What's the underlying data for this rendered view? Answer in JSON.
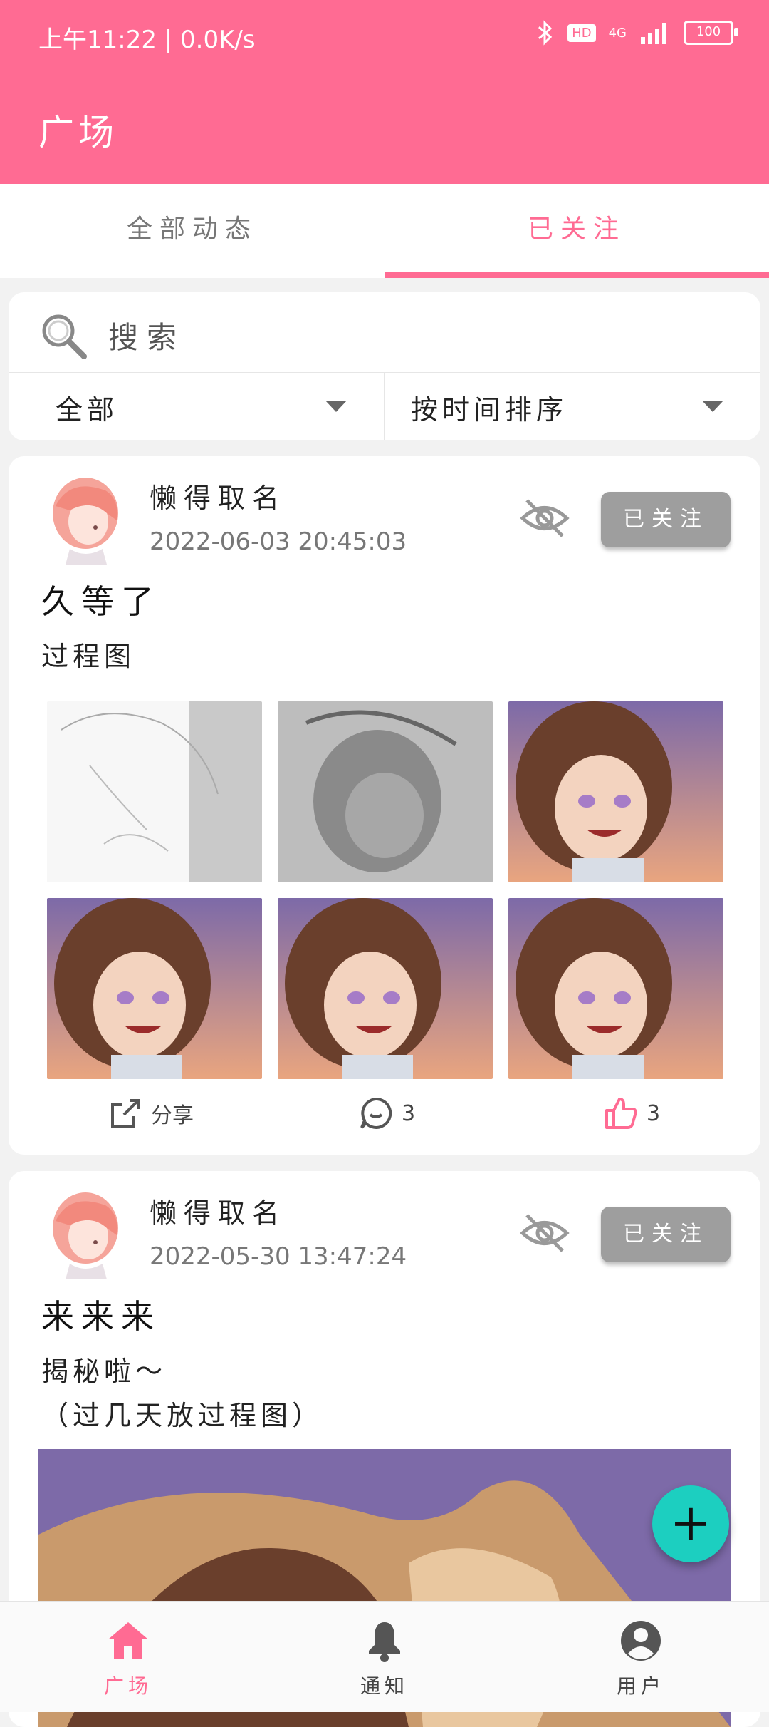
{
  "status_bar": {
    "time": "上午11:22 | 0.0K/s",
    "hd": "HD",
    "network": "4G",
    "battery": "100"
  },
  "app_bar": {
    "title": "广场"
  },
  "tabs": [
    {
      "label": "全部动态",
      "active": false
    },
    {
      "label": "已关注",
      "active": true
    }
  ],
  "search": {
    "placeholder": "搜索",
    "filter_category": "全部",
    "filter_sort": "按时间排序"
  },
  "posts": [
    {
      "user_name": "懒得取名",
      "time": "2022-06-03  20:45:03",
      "follow_label": "已关注",
      "title": "久等了",
      "body": "过程图",
      "images": [
        "lineart-sketch",
        "grayscale-sketch",
        "color-illustration",
        "color-illustration",
        "color-illustration",
        "color-illustration"
      ],
      "share_label": "分享",
      "comment_count": "3",
      "like_count": "3"
    },
    {
      "user_name": "懒得取名",
      "time": "2022-05-30  13:47:24",
      "follow_label": "已关注",
      "title": "来来来",
      "body_line1": "揭秘啦～",
      "body_line2": "（过几天放过程图）"
    }
  ],
  "fab": {
    "icon": "plus-icon",
    "label": "+"
  },
  "bottom_nav": [
    {
      "label": "广场",
      "icon": "home-icon",
      "active": true
    },
    {
      "label": "通知",
      "icon": "bell-icon",
      "active": false
    },
    {
      "label": "用户",
      "icon": "user-icon",
      "active": false
    }
  ],
  "colors": {
    "accent": "#ff6b93",
    "fab": "#1ccfc0",
    "follow_button": "#9e9e9e"
  }
}
